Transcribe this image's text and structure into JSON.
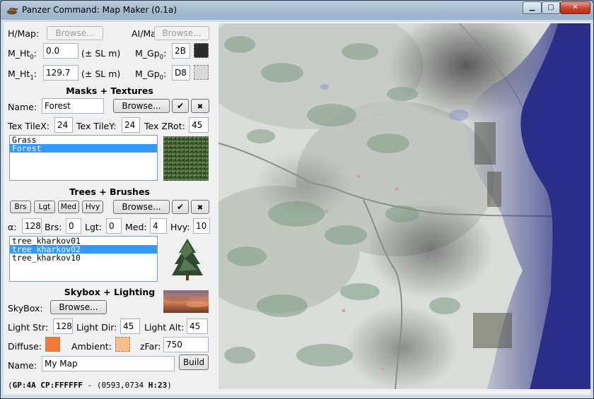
{
  "window": {
    "title": "Panzer Command: Map Maker (0.1a)"
  },
  "hmap": {
    "label": "H/Map:",
    "browse": "Browse..."
  },
  "aimap": {
    "label": "AI/Map:",
    "browse": "Browse..."
  },
  "mht0": {
    "label": "M_Ht",
    "sub": "0",
    "suffix": ":",
    "value": "0.0",
    "unit": "(± SL m)"
  },
  "mht1": {
    "label": "M_Ht",
    "sub": "1",
    "suffix": ":",
    "value": "129.7",
    "unit": "(± SL m)"
  },
  "mgp0": {
    "label": "M_Gp",
    "sub": "0",
    "suffix": ":",
    "value": "2B",
    "color": "#2b2b2b"
  },
  "mgp1": {
    "label": "M_Gp",
    "sub": "0",
    "suffix": ":",
    "value": "D8",
    "color": "#d8d8d8"
  },
  "masks": {
    "title": "Masks + Textures",
    "name_label": "Name:",
    "name_value": "Forest",
    "browse": "Browse...",
    "ok": "✔",
    "del": "✖",
    "tilex_label": "Tex TileX:",
    "tilex": "24",
    "tiley_label": "Tex TileY:",
    "tiley": "24",
    "zrot_label": "Tex ZRot:",
    "zrot": "45",
    "items": [
      "Grass",
      "Forest"
    ],
    "selected": 1
  },
  "trees": {
    "title": "Trees + Brushes",
    "brush_buttons": [
      "Brs",
      "Lgt",
      "Med",
      "Hvy"
    ],
    "browse": "Browse...",
    "ok": "✔",
    "del": "✖",
    "alpha_label": "α:",
    "alpha": "128",
    "brs_label": "Brs:",
    "brs": "0",
    "lgt_label": "Lgt:",
    "lgt": "0",
    "med_label": "Med:",
    "med": "4",
    "hvy_label": "Hvy:",
    "hvy": "10",
    "items": [
      "tree_kharkov01",
      "tree_kharkov02",
      "tree_kharkov10"
    ],
    "selected": 1
  },
  "skybox": {
    "title": "Skybox + Lighting",
    "label": "SkyBox:",
    "browse": "Browse...",
    "lstr_label": "Light Str:",
    "lstr": "128",
    "ldir_label": "Light Dir:",
    "ldir": "45",
    "lalt_label": "Light Alt:",
    "lalt": "45",
    "diffuse_label": "Diffuse:",
    "diffuse_color": "#f57a35",
    "ambient_label": "Ambient:",
    "ambient_color": "#f7c08a",
    "zfar_label": "zFar:",
    "zfar": "750"
  },
  "mapname": {
    "label": "Name:",
    "value": "My Map",
    "build": "Build"
  },
  "status": {
    "gp": "GP:4A",
    "cp": "CP:FFFFFF",
    "mid": " - (0593,0734 ",
    "h": "H:23",
    "end": ")"
  },
  "colors": {
    "selection": "#3399ff",
    "water": "#2a2f8a",
    "terrain": "#d8dcd8"
  }
}
